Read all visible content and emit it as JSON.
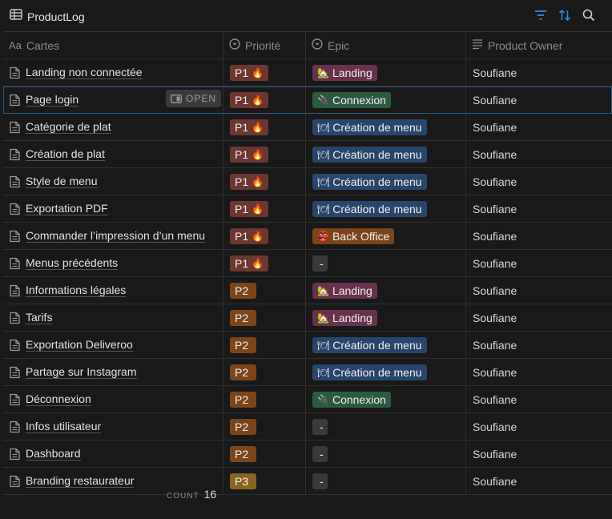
{
  "view": {
    "title": "ProductLog",
    "icon": "table-icon"
  },
  "toolbar": {
    "filter_icon": "filter-icon",
    "sort_icon": "sort-icon",
    "search_icon": "search-icon",
    "accent": "#2e8ad8"
  },
  "columns": [
    {
      "label": "Cartes",
      "icon_text": "Aa"
    },
    {
      "label": "Priorité",
      "icon": "select-icon"
    },
    {
      "label": "Epic",
      "icon": "select-icon"
    },
    {
      "label": "Product Owner",
      "icon": "text-lines-icon"
    }
  ],
  "rows": [
    {
      "title": "Landing non connectée",
      "priority": "P1",
      "prio_emoji": "🔥",
      "prio_class": "p1",
      "epic": "Landing",
      "epic_emoji": "🏡",
      "epic_class": "e-landing",
      "owner": "Soufiane"
    },
    {
      "title": "Page login",
      "priority": "P1",
      "prio_emoji": "🔥",
      "prio_class": "p1",
      "epic": "Connexion",
      "epic_emoji": "🔌",
      "epic_class": "e-connexion",
      "owner": "Soufiane"
    },
    {
      "title": "Catégorie de plat",
      "priority": "P1",
      "prio_emoji": "🔥",
      "prio_class": "p1",
      "epic": "Création de menu",
      "epic_emoji": "🍽",
      "epic_class": "e-menu",
      "owner": "Soufiane"
    },
    {
      "title": "Création de plat",
      "priority": "P1",
      "prio_emoji": "🔥",
      "prio_class": "p1",
      "epic": "Création de menu",
      "epic_emoji": "🍽",
      "epic_class": "e-menu",
      "owner": "Soufiane"
    },
    {
      "title": "Style de menu",
      "priority": "P1",
      "prio_emoji": "🔥",
      "prio_class": "p1",
      "epic": "Création de menu",
      "epic_emoji": "🍽",
      "epic_class": "e-menu",
      "owner": "Soufiane"
    },
    {
      "title": "Exportation PDF",
      "priority": "P1",
      "prio_emoji": "🔥",
      "prio_class": "p1",
      "epic": "Création de menu",
      "epic_emoji": "🍽",
      "epic_class": "e-menu",
      "owner": "Soufiane"
    },
    {
      "title": "Commander l’impression d’un menu",
      "priority": "P1",
      "prio_emoji": "🔥",
      "prio_class": "p1",
      "epic": "Back Office",
      "epic_emoji": "👺",
      "epic_class": "e-back",
      "owner": "Soufiane"
    },
    {
      "title": "Menus précédents",
      "priority": "P1",
      "prio_emoji": "🔥",
      "prio_class": "p1",
      "epic": "-",
      "epic_emoji": "",
      "epic_class": "e-none",
      "owner": "Soufiane"
    },
    {
      "title": "Informations légales",
      "priority": "P2",
      "prio_emoji": "",
      "prio_class": "p2",
      "epic": "Landing",
      "epic_emoji": "🏡",
      "epic_class": "e-landing",
      "owner": "Soufiane"
    },
    {
      "title": "Tarifs",
      "priority": "P2",
      "prio_emoji": "",
      "prio_class": "p2",
      "epic": "Landing",
      "epic_emoji": "🏡",
      "epic_class": "e-landing",
      "owner": "Soufiane"
    },
    {
      "title": "Exportation Deliveroo",
      "priority": "P2",
      "prio_emoji": "",
      "prio_class": "p2",
      "epic": "Création de menu",
      "epic_emoji": "🍽",
      "epic_class": "e-menu",
      "owner": "Soufiane"
    },
    {
      "title": "Partage sur Instagram",
      "priority": "P2",
      "prio_emoji": "",
      "prio_class": "p2",
      "epic": "Création de menu",
      "epic_emoji": "🍽",
      "epic_class": "e-menu",
      "owner": "Soufiane"
    },
    {
      "title": "Déconnexion",
      "priority": "P2",
      "prio_emoji": "",
      "prio_class": "p2",
      "epic": "Connexion",
      "epic_emoji": "🔌",
      "epic_class": "e-connexion",
      "owner": "Soufiane"
    },
    {
      "title": "Infos utilisateur",
      "priority": "P2",
      "prio_emoji": "",
      "prio_class": "p2",
      "epic": "-",
      "epic_emoji": "",
      "epic_class": "e-none",
      "owner": "Soufiane"
    },
    {
      "title": "Dashboard",
      "priority": "P2",
      "prio_emoji": "",
      "prio_class": "p2",
      "epic": "-",
      "epic_emoji": "",
      "epic_class": "e-none",
      "owner": "Soufiane"
    },
    {
      "title": "Branding restaurateur",
      "priority": "P3",
      "prio_emoji": "",
      "prio_class": "p3",
      "epic": "-",
      "epic_emoji": "",
      "epic_class": "e-none",
      "owner": "Soufiane"
    }
  ],
  "selected_row": {
    "open_label": "OPEN",
    "open_icon": "side-peek-icon"
  },
  "footer": {
    "count_label": "COUNT",
    "count_value": "16"
  }
}
